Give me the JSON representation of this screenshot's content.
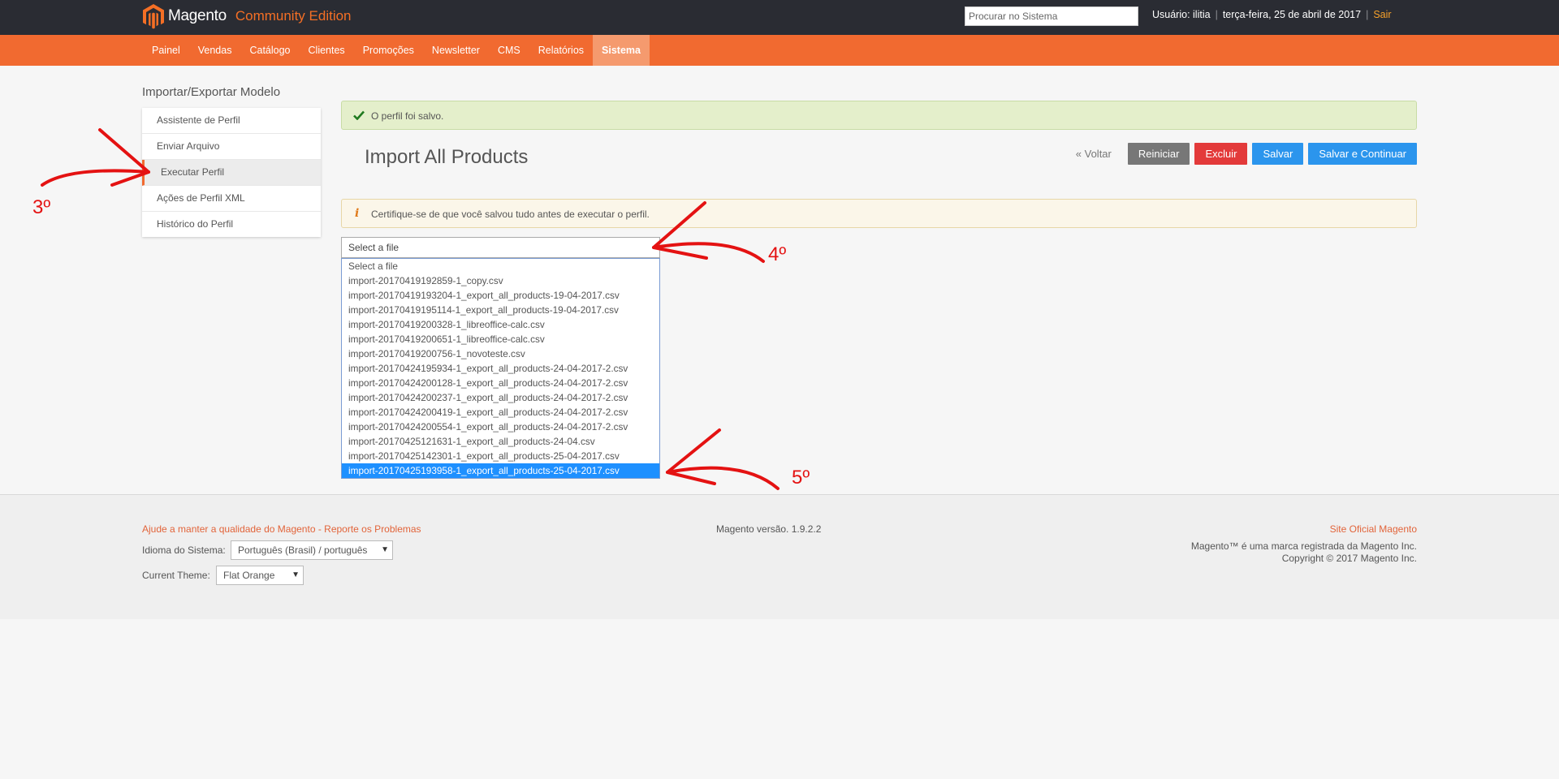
{
  "header": {
    "brand": "Magento",
    "edition": "Community Edition",
    "search_placeholder": "Procurar no Sistema",
    "user_label": "Usuário: ilitia",
    "date": "terça-feira, 25 de abril de 2017",
    "logout": "Sair"
  },
  "nav": {
    "items": [
      "Painel",
      "Vendas",
      "Catálogo",
      "Clientes",
      "Promoções",
      "Newsletter",
      "CMS",
      "Relatórios",
      "Sistema"
    ],
    "active": "Sistema"
  },
  "sidebar": {
    "title": "Importar/Exportar Modelo",
    "items": [
      {
        "label": "Assistente de Perfil"
      },
      {
        "label": "Enviar Arquivo"
      },
      {
        "label": "Executar Perfil"
      },
      {
        "label": "Ações de Perfil XML"
      },
      {
        "label": "Histórico do Perfil"
      }
    ],
    "active": "Executar Perfil"
  },
  "messages": {
    "success": "O perfil foi salvo.",
    "notice": "Certifique-se de que você salvou tudo antes de executar o perfil."
  },
  "main": {
    "title": "Import All Products",
    "back": "« Voltar",
    "buttons": {
      "reset": "Reiniciar",
      "delete": "Excluir",
      "save": "Salvar",
      "save_continue": "Salvar e Continuar"
    }
  },
  "file_select": {
    "current": "Select a file",
    "options": [
      "Select a file",
      "import-20170419192859-1_copy.csv",
      "import-20170419193204-1_export_all_products-19-04-2017.csv",
      "import-20170419195114-1_export_all_products-19-04-2017.csv",
      "import-20170419200328-1_libreoffice-calc.csv",
      "import-20170419200651-1_libreoffice-calc.csv",
      "import-20170419200756-1_novoteste.csv",
      "import-20170424195934-1_export_all_products-24-04-2017-2.csv",
      "import-20170424200128-1_export_all_products-24-04-2017-2.csv",
      "import-20170424200237-1_export_all_products-24-04-2017-2.csv",
      "import-20170424200419-1_export_all_products-24-04-2017-2.csv",
      "import-20170424200554-1_export_all_products-24-04-2017-2.csv",
      "import-20170425121631-1_export_all_products-24-04.csv",
      "import-20170425142301-1_export_all_products-25-04-2017.csv",
      "import-20170425193958-1_export_all_products-25-04-2017.csv"
    ],
    "highlighted": "import-20170425193958-1_export_all_products-25-04-2017.csv"
  },
  "footer": {
    "help_link": "Ajude a manter a qualidade do Magento - Reporte os Problemas",
    "language_label": "Idioma do Sistema:",
    "language_value": "Português (Brasil) / português",
    "theme_label": "Current Theme:",
    "theme_value": "Flat Orange",
    "version": "Magento versão. 1.9.2.2",
    "official_site": "Site Oficial Magento",
    "trademark": "Magento™ é uma marca registrada da Magento Inc.",
    "copyright": "Copyright © 2017 Magento Inc."
  },
  "annotations": {
    "step3": "3º",
    "step4": "4º",
    "step5": "5º",
    "color": "#e41212"
  },
  "colors": {
    "topbar": "#2a2c33",
    "nav": "#f16a30",
    "accent": "#f46f25",
    "button_blue": "#2b95ed",
    "button_red": "#e33a3a",
    "button_gray": "#777777"
  }
}
